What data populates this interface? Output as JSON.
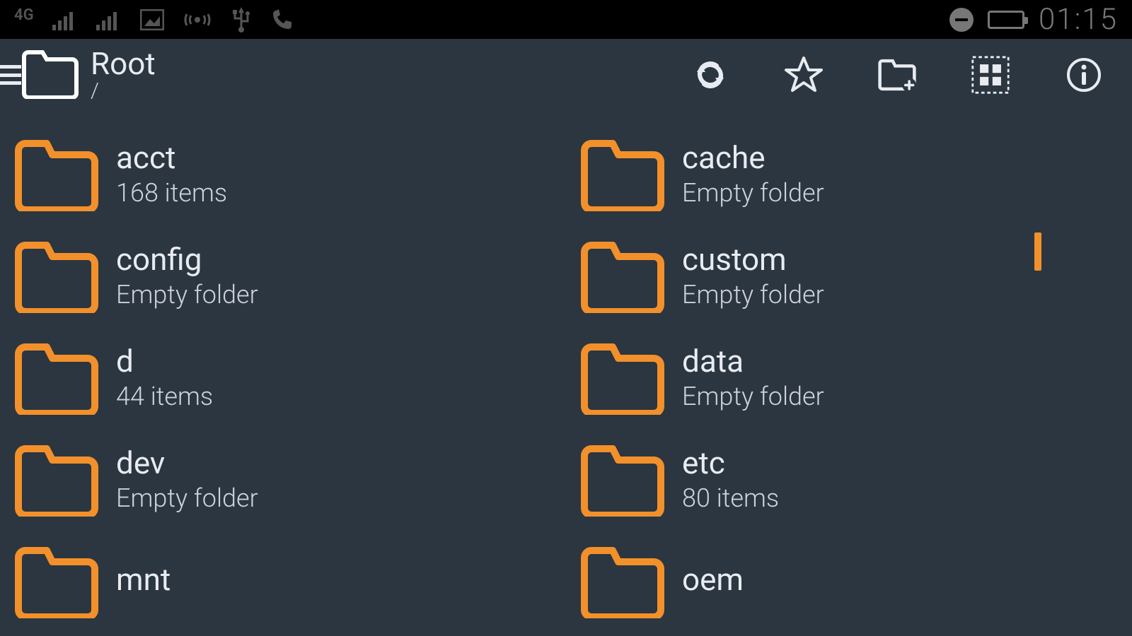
{
  "statusbar": {
    "network_label": "4G",
    "clock": "01:15"
  },
  "appbar": {
    "title": "Root",
    "path": "/"
  },
  "items": [
    {
      "name": "acct",
      "sub": "168 items"
    },
    {
      "name": "cache",
      "sub": "Empty folder"
    },
    {
      "name": "config",
      "sub": "Empty folder"
    },
    {
      "name": "custom",
      "sub": "Empty folder"
    },
    {
      "name": "d",
      "sub": "44 items"
    },
    {
      "name": "data",
      "sub": "Empty folder"
    },
    {
      "name": "dev",
      "sub": "Empty folder"
    },
    {
      "name": "etc",
      "sub": "80 items"
    },
    {
      "name": "mnt",
      "sub": ""
    },
    {
      "name": "oem",
      "sub": ""
    }
  ],
  "colors": {
    "accent": "#f2902b",
    "bg": "#2b3640",
    "fg": "#e8ebf0"
  }
}
